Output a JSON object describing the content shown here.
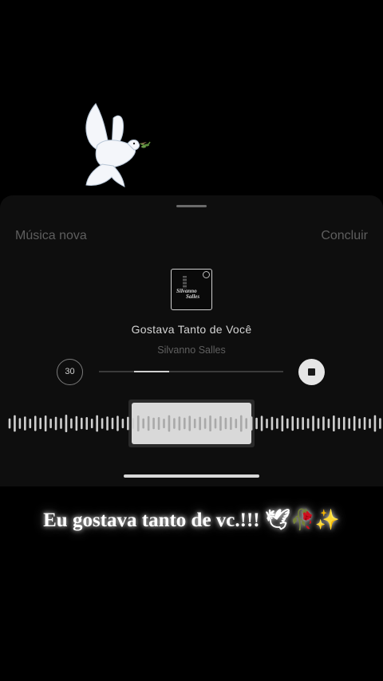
{
  "header": {
    "left_label": "Música nova",
    "right_label": "Concluir"
  },
  "album_art": {
    "text_line1": "Silvanno",
    "text_line2": "Salles"
  },
  "song": {
    "title": "Gostava Tanto de Você",
    "artist": "Silvanno Salles"
  },
  "player": {
    "duration_label": "30",
    "progress_start": 0.19,
    "progress_end": 0.38
  },
  "waveform": {
    "bar_heights": [
      0.32,
      0.52,
      0.34,
      0.44,
      0.3,
      0.48,
      0.36,
      0.5,
      0.3,
      0.42,
      0.34,
      0.55,
      0.32,
      0.46,
      0.36,
      0.4,
      0.3,
      0.52,
      0.34,
      0.44,
      0.36,
      0.48,
      0.3,
      0.42,
      0.34,
      0.5,
      0.32,
      0.46,
      0.36,
      0.4,
      0.3,
      0.52,
      0.34,
      0.44,
      0.36,
      0.48,
      0.3,
      0.42,
      0.34,
      0.5,
      0.32,
      0.46,
      0.36,
      0.4,
      0.3,
      0.52,
      0.34,
      0.44,
      0.36,
      0.48,
      0.3,
      0.42,
      0.34,
      0.5,
      0.32,
      0.46,
      0.36,
      0.4,
      0.32,
      0.48,
      0.34,
      0.44,
      0.3,
      0.5,
      0.36,
      0.42,
      0.34,
      0.46,
      0.32,
      0.4,
      0.3,
      0.52,
      0.34
    ]
  },
  "caption": {
    "text": "Eu gostava tanto de vc.!!! 🕊🥀✨"
  },
  "colors": {
    "background": "#000000",
    "sheet": "#0e0e0e",
    "text_primary": "#d4d4d4",
    "text_muted": "#5f5f5f"
  },
  "icons": {
    "sticker": "dove-icon",
    "stop": "stop-icon"
  }
}
